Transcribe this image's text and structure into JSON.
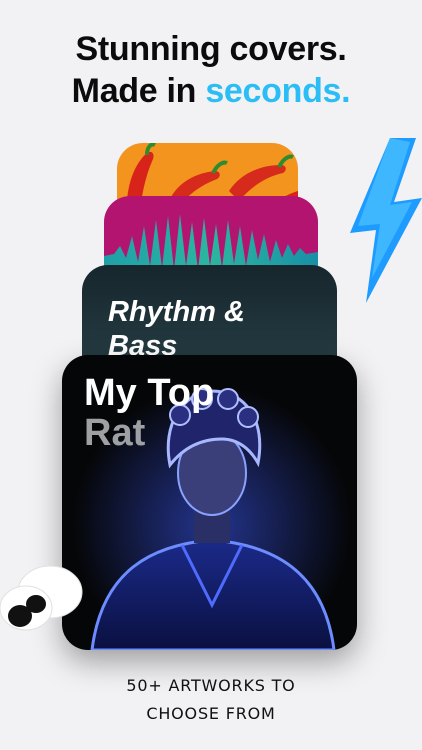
{
  "headline": {
    "line1": "Stunning covers.",
    "line2_prefix": "Made in",
    "line2_accent": "seconds."
  },
  "cards": {
    "rhythm": {
      "line1": "Rhythm &",
      "line2": "Bass"
    },
    "top_rated": {
      "line1": "My Top",
      "line2": "Rat"
    }
  },
  "footer": {
    "line1": "50+ ARTWORKS TO",
    "line2": "CHOOSE FROM"
  },
  "colors": {
    "accent": "#2bbdf5",
    "background": "#f2f2f4",
    "neon_glow": "#5b7dff"
  },
  "icons": [
    "chili-pepper-icon",
    "lightning-bolt-icon",
    "googly-eyes-icon"
  ]
}
